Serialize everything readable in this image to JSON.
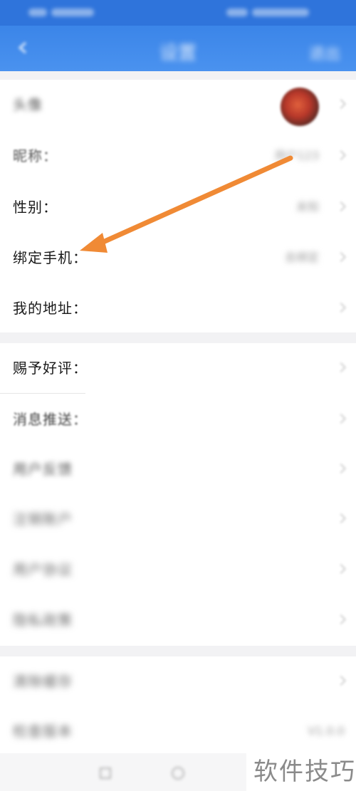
{
  "app_bar": {
    "title": "设置",
    "action_label": "退出"
  },
  "profile": {
    "rows": [
      {
        "label": "头像",
        "value": ""
      },
      {
        "label": "昵称：",
        "value": "用户123"
      },
      {
        "label": "性别：",
        "value": "未知"
      },
      {
        "label": "绑定手机：",
        "value": "去绑定"
      },
      {
        "label": "我的地址：",
        "value": ""
      }
    ]
  },
  "settings": {
    "rows": [
      {
        "label": "赐予好评：",
        "value": ""
      },
      {
        "label": "消息推送：",
        "value": ""
      },
      {
        "label": "用户反馈",
        "value": ""
      },
      {
        "label": "注销账户",
        "value": ""
      },
      {
        "label": "用户协议",
        "value": ""
      },
      {
        "label": "隐私政策",
        "value": ""
      }
    ]
  },
  "more": {
    "rows": [
      {
        "label": "清除缓存",
        "value": ""
      },
      {
        "label": "检查版本",
        "value": "V1.0.0"
      }
    ]
  },
  "watermark": "软件技巧",
  "colors": {
    "header": "#3b85e8",
    "status_bar": "#2f74db",
    "annotation_arrow": "#f08a35",
    "background": "#f2f2f4"
  }
}
